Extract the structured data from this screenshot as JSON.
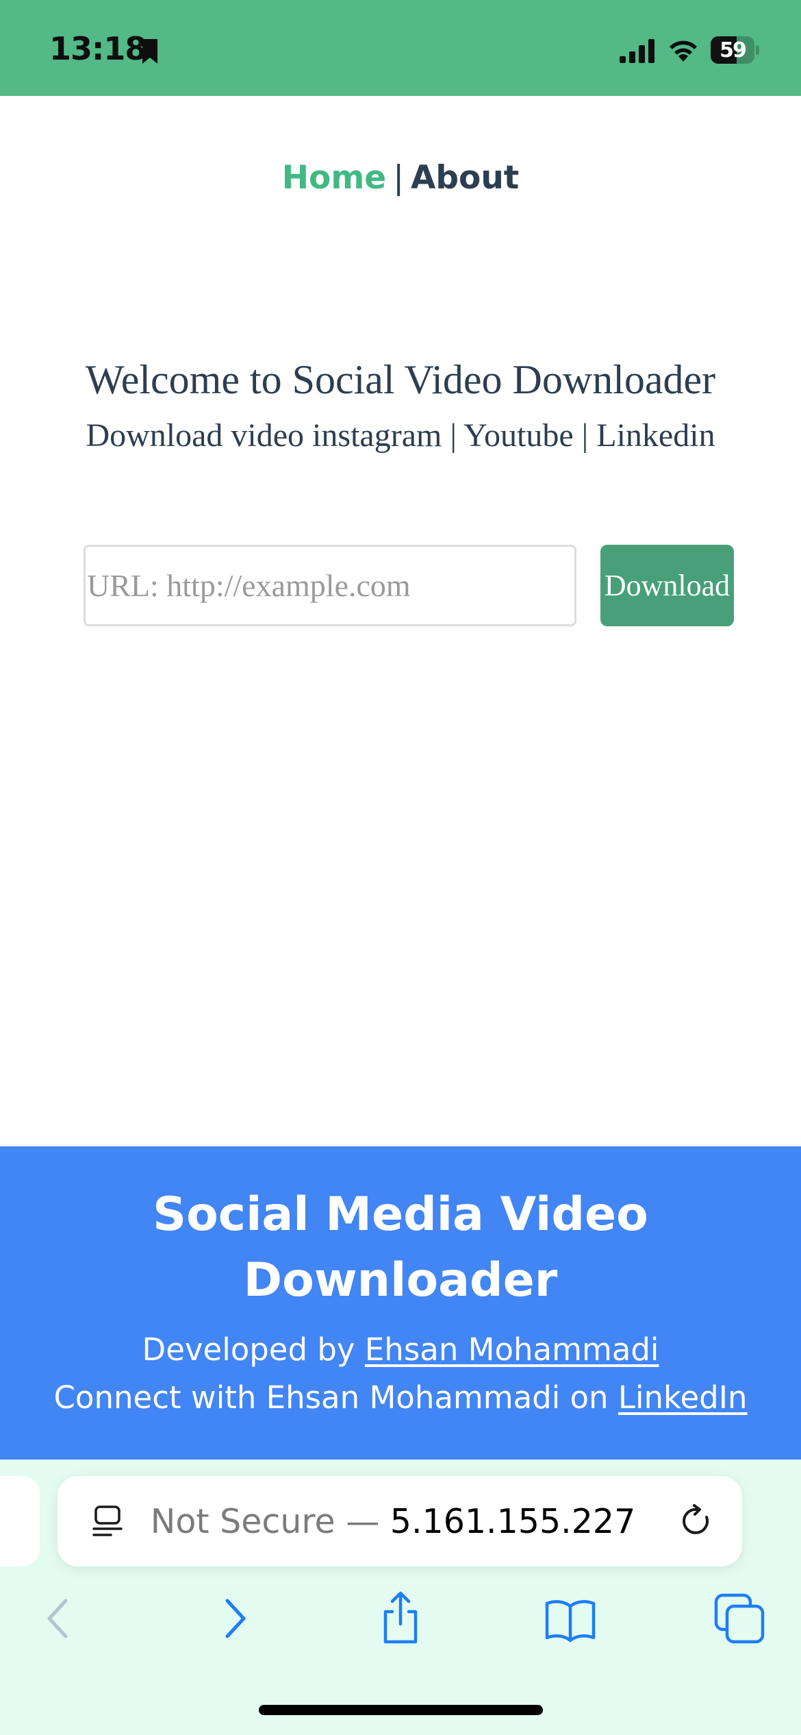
{
  "status_bar": {
    "time": "13:18",
    "battery_level": "59",
    "battery_fraction": 0.59,
    "color": "#52b987"
  },
  "nav": {
    "home": "Home",
    "separator": "|",
    "about": "About",
    "active_color": "#42b983"
  },
  "hero": {
    "title": "Welcome to Social Video Downloader",
    "subtitle": "Download video instagram | Youtube | Linkedin"
  },
  "form": {
    "url_placeholder": "URL: http://example.com",
    "url_value": "",
    "download_label": "Download",
    "button_color": "#47a077"
  },
  "footer": {
    "title": "Social Media Video Downloader",
    "developed_prefix": "Developed by ",
    "developer_name": "Ehsan Mohammadi",
    "connect_prefix": "Connect with Ehsan Mohammadi on ",
    "linkedin_label": "LinkedIn",
    "color": "#4285f4"
  },
  "browser": {
    "security_label": "Not Secure — ",
    "host": "5.161.155.227",
    "icons": {
      "page_menu": "page-menu-icon",
      "reload": "reload-icon",
      "back": "chevron-left-icon",
      "forward": "chevron-right-icon",
      "share": "share-icon",
      "bookmarks": "book-icon",
      "tabs": "tabs-icon"
    }
  }
}
